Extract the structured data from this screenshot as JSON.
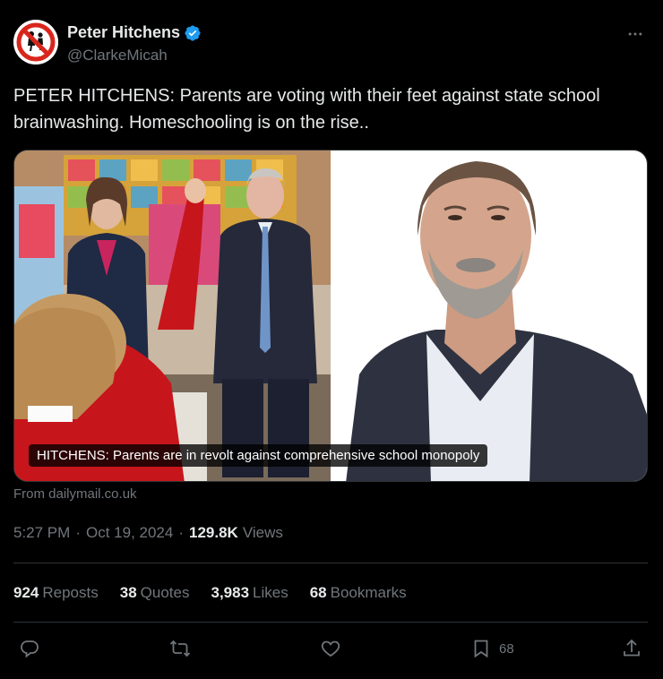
{
  "author": {
    "display_name": "Peter Hitchens",
    "handle": "@ClarkeMicah",
    "verified": true,
    "avatar_icon": "no-children-sign-icon"
  },
  "tweet": {
    "text": "PETER HITCHENS: Parents are voting with their feet against state school brainwashing. Homeschooling is on the rise..",
    "media_caption": "HITCHENS: Parents are in revolt against comprehensive school monopoly",
    "source": "From dailymail.co.uk",
    "time": "5:27 PM",
    "date": "Oct 19, 2024",
    "views_count": "129.8K",
    "views_label": "Views"
  },
  "stats": {
    "reposts_count": "924",
    "reposts_label": "Reposts",
    "quotes_count": "38",
    "quotes_label": "Quotes",
    "likes_count": "3,983",
    "likes_label": "Likes",
    "bookmarks_count": "68",
    "bookmarks_label": "Bookmarks"
  },
  "actions": {
    "bookmark_count": "68"
  },
  "colors": {
    "background": "#000000",
    "text": "#e7e9ea",
    "muted": "#71767b",
    "divider": "#2f3336",
    "verified": "#1d9bf0"
  }
}
